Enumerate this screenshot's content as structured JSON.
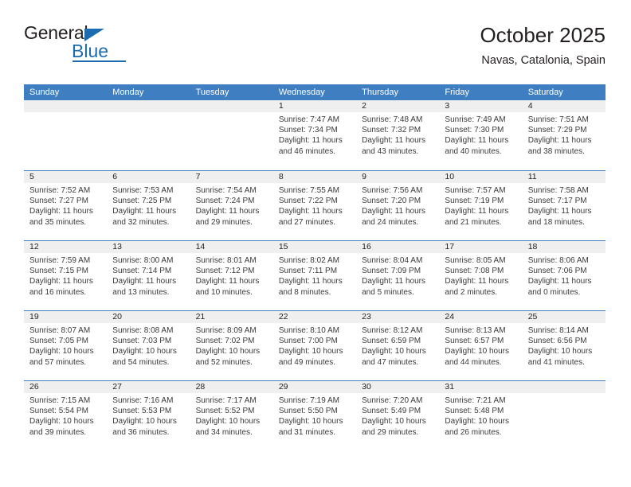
{
  "brand": {
    "name_top": "General",
    "name_bottom": "Blue"
  },
  "header": {
    "title": "October 2025",
    "location": "Navas, Catalonia, Spain"
  },
  "weekday_headers": [
    "Sunday",
    "Monday",
    "Tuesday",
    "Wednesday",
    "Thursday",
    "Friday",
    "Saturday"
  ],
  "colors": {
    "header_blue": "#3f7fc1",
    "brand_blue": "#1b6cb0",
    "daynum_band": "#efefef",
    "text": "#231f20"
  },
  "weeks": [
    [
      {
        "day": "",
        "lines": []
      },
      {
        "day": "",
        "lines": []
      },
      {
        "day": "",
        "lines": []
      },
      {
        "day": "1",
        "lines": [
          "Sunrise: 7:47 AM",
          "Sunset: 7:34 PM",
          "Daylight: 11 hours",
          "and 46 minutes."
        ]
      },
      {
        "day": "2",
        "lines": [
          "Sunrise: 7:48 AM",
          "Sunset: 7:32 PM",
          "Daylight: 11 hours",
          "and 43 minutes."
        ]
      },
      {
        "day": "3",
        "lines": [
          "Sunrise: 7:49 AM",
          "Sunset: 7:30 PM",
          "Daylight: 11 hours",
          "and 40 minutes."
        ]
      },
      {
        "day": "4",
        "lines": [
          "Sunrise: 7:51 AM",
          "Sunset: 7:29 PM",
          "Daylight: 11 hours",
          "and 38 minutes."
        ]
      }
    ],
    [
      {
        "day": "5",
        "lines": [
          "Sunrise: 7:52 AM",
          "Sunset: 7:27 PM",
          "Daylight: 11 hours",
          "and 35 minutes."
        ]
      },
      {
        "day": "6",
        "lines": [
          "Sunrise: 7:53 AM",
          "Sunset: 7:25 PM",
          "Daylight: 11 hours",
          "and 32 minutes."
        ]
      },
      {
        "day": "7",
        "lines": [
          "Sunrise: 7:54 AM",
          "Sunset: 7:24 PM",
          "Daylight: 11 hours",
          "and 29 minutes."
        ]
      },
      {
        "day": "8",
        "lines": [
          "Sunrise: 7:55 AM",
          "Sunset: 7:22 PM",
          "Daylight: 11 hours",
          "and 27 minutes."
        ]
      },
      {
        "day": "9",
        "lines": [
          "Sunrise: 7:56 AM",
          "Sunset: 7:20 PM",
          "Daylight: 11 hours",
          "and 24 minutes."
        ]
      },
      {
        "day": "10",
        "lines": [
          "Sunrise: 7:57 AM",
          "Sunset: 7:19 PM",
          "Daylight: 11 hours",
          "and 21 minutes."
        ]
      },
      {
        "day": "11",
        "lines": [
          "Sunrise: 7:58 AM",
          "Sunset: 7:17 PM",
          "Daylight: 11 hours",
          "and 18 minutes."
        ]
      }
    ],
    [
      {
        "day": "12",
        "lines": [
          "Sunrise: 7:59 AM",
          "Sunset: 7:15 PM",
          "Daylight: 11 hours",
          "and 16 minutes."
        ]
      },
      {
        "day": "13",
        "lines": [
          "Sunrise: 8:00 AM",
          "Sunset: 7:14 PM",
          "Daylight: 11 hours",
          "and 13 minutes."
        ]
      },
      {
        "day": "14",
        "lines": [
          "Sunrise: 8:01 AM",
          "Sunset: 7:12 PM",
          "Daylight: 11 hours",
          "and 10 minutes."
        ]
      },
      {
        "day": "15",
        "lines": [
          "Sunrise: 8:02 AM",
          "Sunset: 7:11 PM",
          "Daylight: 11 hours",
          "and 8 minutes."
        ]
      },
      {
        "day": "16",
        "lines": [
          "Sunrise: 8:04 AM",
          "Sunset: 7:09 PM",
          "Daylight: 11 hours",
          "and 5 minutes."
        ]
      },
      {
        "day": "17",
        "lines": [
          "Sunrise: 8:05 AM",
          "Sunset: 7:08 PM",
          "Daylight: 11 hours",
          "and 2 minutes."
        ]
      },
      {
        "day": "18",
        "lines": [
          "Sunrise: 8:06 AM",
          "Sunset: 7:06 PM",
          "Daylight: 11 hours",
          "and 0 minutes."
        ]
      }
    ],
    [
      {
        "day": "19",
        "lines": [
          "Sunrise: 8:07 AM",
          "Sunset: 7:05 PM",
          "Daylight: 10 hours",
          "and 57 minutes."
        ]
      },
      {
        "day": "20",
        "lines": [
          "Sunrise: 8:08 AM",
          "Sunset: 7:03 PM",
          "Daylight: 10 hours",
          "and 54 minutes."
        ]
      },
      {
        "day": "21",
        "lines": [
          "Sunrise: 8:09 AM",
          "Sunset: 7:02 PM",
          "Daylight: 10 hours",
          "and 52 minutes."
        ]
      },
      {
        "day": "22",
        "lines": [
          "Sunrise: 8:10 AM",
          "Sunset: 7:00 PM",
          "Daylight: 10 hours",
          "and 49 minutes."
        ]
      },
      {
        "day": "23",
        "lines": [
          "Sunrise: 8:12 AM",
          "Sunset: 6:59 PM",
          "Daylight: 10 hours",
          "and 47 minutes."
        ]
      },
      {
        "day": "24",
        "lines": [
          "Sunrise: 8:13 AM",
          "Sunset: 6:57 PM",
          "Daylight: 10 hours",
          "and 44 minutes."
        ]
      },
      {
        "day": "25",
        "lines": [
          "Sunrise: 8:14 AM",
          "Sunset: 6:56 PM",
          "Daylight: 10 hours",
          "and 41 minutes."
        ]
      }
    ],
    [
      {
        "day": "26",
        "lines": [
          "Sunrise: 7:15 AM",
          "Sunset: 5:54 PM",
          "Daylight: 10 hours",
          "and 39 minutes."
        ]
      },
      {
        "day": "27",
        "lines": [
          "Sunrise: 7:16 AM",
          "Sunset: 5:53 PM",
          "Daylight: 10 hours",
          "and 36 minutes."
        ]
      },
      {
        "day": "28",
        "lines": [
          "Sunrise: 7:17 AM",
          "Sunset: 5:52 PM",
          "Daylight: 10 hours",
          "and 34 minutes."
        ]
      },
      {
        "day": "29",
        "lines": [
          "Sunrise: 7:19 AM",
          "Sunset: 5:50 PM",
          "Daylight: 10 hours",
          "and 31 minutes."
        ]
      },
      {
        "day": "30",
        "lines": [
          "Sunrise: 7:20 AM",
          "Sunset: 5:49 PM",
          "Daylight: 10 hours",
          "and 29 minutes."
        ]
      },
      {
        "day": "31",
        "lines": [
          "Sunrise: 7:21 AM",
          "Sunset: 5:48 PM",
          "Daylight: 10 hours",
          "and 26 minutes."
        ]
      },
      {
        "day": "",
        "lines": []
      }
    ]
  ]
}
